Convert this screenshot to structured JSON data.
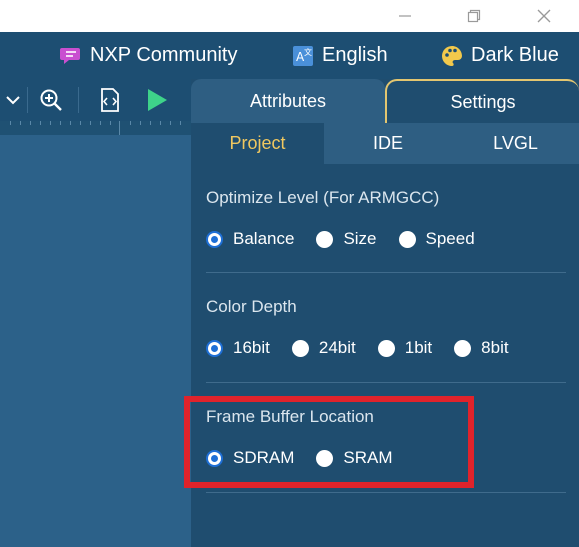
{
  "window_controls": {
    "minimize_icon": "minimize-icon",
    "restore_icon": "restore-icon",
    "close_icon": "close-icon"
  },
  "topbar": {
    "community": {
      "label": "NXP Community",
      "icon": "chat-bubble-icon",
      "icon_color": "#c94fd0"
    },
    "language": {
      "label": "English",
      "icon": "translate-icon",
      "icon_color": "#4a90d9"
    },
    "theme": {
      "label": "Dark Blue",
      "icon": "palette-icon",
      "icon_color": "#f2c94c"
    }
  },
  "toolbar": {
    "items": [
      {
        "icon": "chevron-down-icon"
      },
      {
        "icon": "zoom-in-icon"
      },
      {
        "icon": "code-file-icon"
      },
      {
        "icon": "play-icon",
        "color": "#3ed38a"
      }
    ]
  },
  "panel": {
    "tabs": [
      {
        "label": "Attributes"
      },
      {
        "label": "Settings",
        "active": true
      }
    ],
    "sub_tabs": [
      {
        "label": "Project",
        "active": true
      },
      {
        "label": "IDE"
      },
      {
        "label": "LVGL"
      }
    ],
    "sections": [
      {
        "title": "Optimize Level (For ARMGCC)",
        "options": [
          "Balance",
          "Size",
          "Speed"
        ],
        "selected": "Balance"
      },
      {
        "title": "Color Depth",
        "options": [
          "16bit",
          "24bit",
          "1bit",
          "8bit"
        ],
        "selected": "16bit"
      },
      {
        "title": "Frame Buffer Location",
        "options": [
          "SDRAM",
          "SRAM"
        ],
        "selected": "SDRAM"
      }
    ]
  },
  "colors": {
    "accent_gold": "#e3c670",
    "selected_radio": "#1e6fd6",
    "highlight_box": "#e0232b"
  }
}
